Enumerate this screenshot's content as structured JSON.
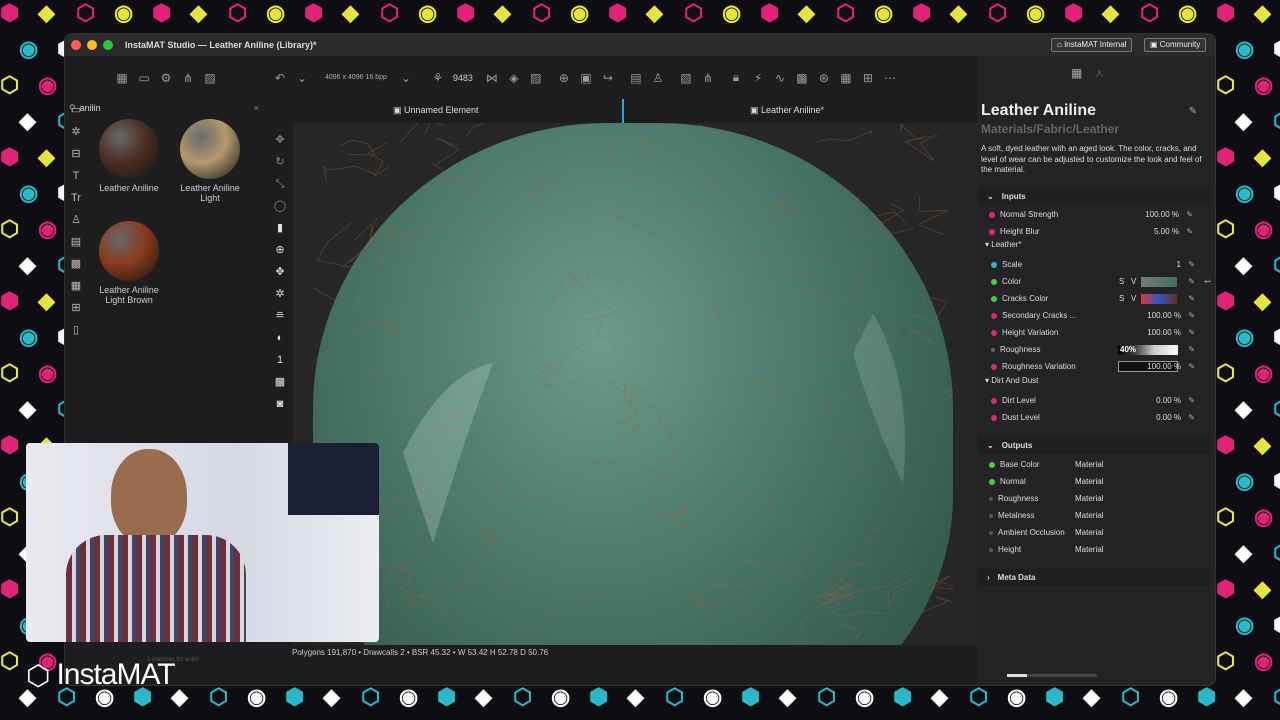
{
  "window": {
    "title": "InstaMAT Studio — Leather Aniline (Library)*",
    "btn_internal": "InstaMAT Internal",
    "btn_community": "Community"
  },
  "toolbar": {
    "resolution": "4096 x 4096 16 bpp",
    "seed": "9483"
  },
  "library": {
    "search_value": "anilin",
    "items": [
      {
        "label": "Leather Aniline",
        "color": "#4a2e22"
      },
      {
        "label": "Leather Aniline Light",
        "color": "#b39a6c"
      },
      {
        "label": "Leather Aniline Light Brown",
        "color": "#8a3a1c"
      }
    ],
    "footer": "3 matches for anilin"
  },
  "viewport": {
    "tab_left": "Unnamed Element",
    "tab_right": "Leather Aniline*",
    "status": "Polygons 191,870 • Drawcalls 2 • BSR 45.32 • W 53.42 H 52.78 D 50.76",
    "tool_number": "1"
  },
  "props": {
    "title": "Leather Aniline",
    "path": "Materials/Fabric/Leather",
    "description": "A soft, dyed leather with an aged look. The color, cracks, and level of wear can be adjusted to customize the look and feel of the material.",
    "inputs_label": "Inputs",
    "normal_strength": {
      "label": "Normal Strength",
      "value": "100.00 %"
    },
    "height_blur": {
      "label": "Height Blur",
      "value": "5.00 %"
    },
    "leather_group": "Leather*",
    "scale": {
      "label": "Scale",
      "value": "1"
    },
    "color": {
      "label": "Color",
      "s": "S",
      "v": "V"
    },
    "cracks_color": {
      "label": "Cracks Color",
      "s": "S",
      "v": "V"
    },
    "secondary_cracks": {
      "label": "Secondary Cracks ...",
      "value": "100.00 %"
    },
    "height_variation": {
      "label": "Height Variation",
      "value": "100.00 %"
    },
    "roughness": {
      "label": "Roughness",
      "value": "40%"
    },
    "roughness_variation": {
      "label": "Roughness Variation",
      "value": "100.00 %"
    },
    "dirt_group": "Dirt And Dust",
    "dirt_level": {
      "label": "Dirt Level",
      "value": "0.00 %"
    },
    "dust_level": {
      "label": "Dust Level",
      "value": "0.00 %"
    },
    "outputs_label": "Outputs",
    "outputs": [
      {
        "label": "Base Color",
        "type": "Material"
      },
      {
        "label": "Normal",
        "type": "Material"
      },
      {
        "label": "Roughness",
        "type": "Material"
      },
      {
        "label": "Metalness",
        "type": "Material"
      },
      {
        "label": "Ambient Occlusion",
        "type": "Material"
      },
      {
        "label": "Height",
        "type": "Material"
      }
    ],
    "meta_label": "Meta Data"
  },
  "brand": {
    "logo": "InstaMAT"
  },
  "colors": {
    "accent": "#e0237a",
    "green": "#3ed33e",
    "teal": "#2bb6c9"
  }
}
